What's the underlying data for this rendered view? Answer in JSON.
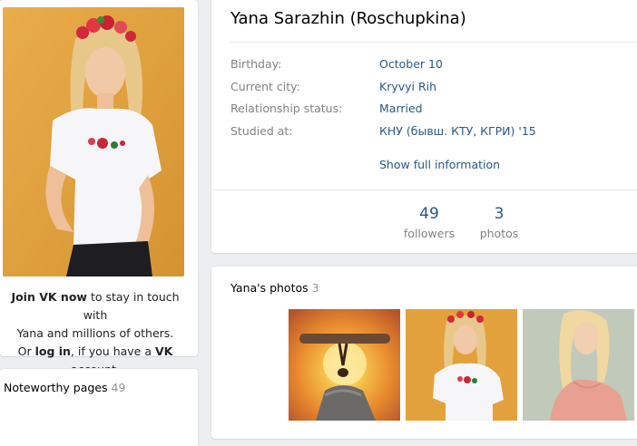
{
  "profile": {
    "name": "Yana Sarazhin (Roschupkina)",
    "info": [
      {
        "label": "Birthday:",
        "value": "October 10"
      },
      {
        "label": "Current city:",
        "value": "Kryvyi Rih"
      },
      {
        "label": "Relationship status:",
        "value": "Married"
      },
      {
        "label": "Studied at:",
        "value": "КНУ (бывш. КТУ, КГРИ) '15"
      }
    ],
    "show_full": "Show full information",
    "counts": [
      {
        "number": "49",
        "label": "followers"
      },
      {
        "number": "3",
        "label": "photos"
      }
    ]
  },
  "join": {
    "join_link": "Join VK now",
    "join_rest": " to stay in touch with",
    "line2": "Yana and millions of others.",
    "or": "Or ",
    "login_link": "log in",
    "mid": ", if you have a ",
    "vk": "VK",
    "end": " account."
  },
  "noteworthy": {
    "title": "Noteworthy pages",
    "count": "49"
  },
  "photos": {
    "title": "Yana's photos",
    "count": "3"
  },
  "colors": {
    "link": "#2a5885",
    "muted": "#828282",
    "background": "#edeef0"
  }
}
